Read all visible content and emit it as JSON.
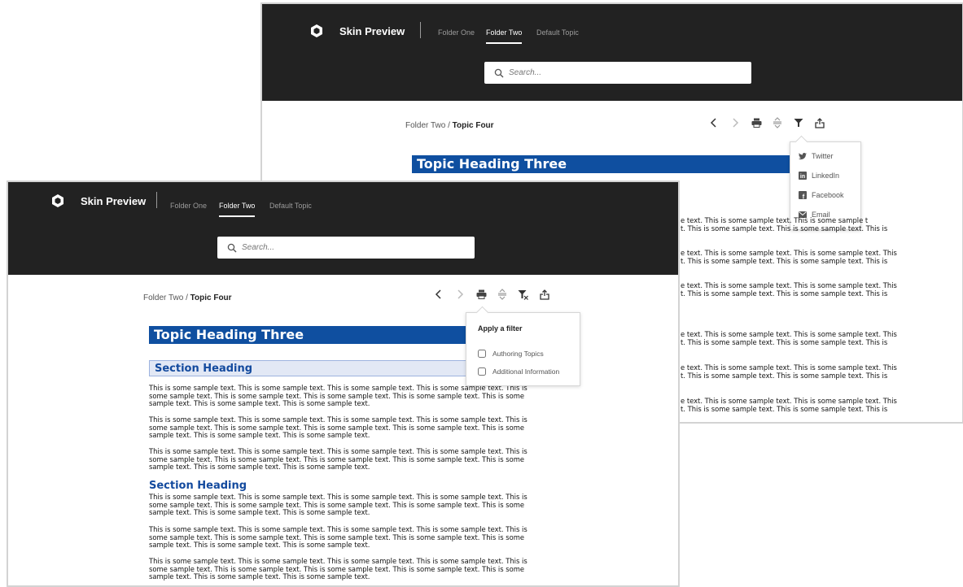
{
  "app": {
    "brand": "Skin Preview",
    "nav": [
      "Folder One",
      "Folder Two",
      "Default Topic"
    ],
    "active_nav": "Folder Two",
    "search_placeholder": "Search..."
  },
  "breadcrumb": {
    "parent": "Folder Two",
    "separator": "/",
    "current": "Topic Four"
  },
  "toolbar_icons": [
    "chevron-left-icon",
    "chevron-right-icon",
    "print-icon",
    "expand-collapse-icon",
    "filter-icon",
    "share-icon"
  ],
  "content": {
    "topic_heading": "Topic Heading Three",
    "section_heading": "Section Heading",
    "paragraph": "This is some sample text. This is some sample text. This is some sample text. This is some sample text. This is some sample text. This is some sample text. This is some sample text. This is some sample text. This is some sample text. This is some sample text. This is some sample text.",
    "fragments": {
      "a1": "e text. This is some sample text. This is some sample t",
      "a2": "t. This is some sample text. This is some sample text. This is",
      "b1": "e text. This is some sample text. This is some sample text. This",
      "b2": "t. This is some sample text. This is some sample text. This is"
    }
  },
  "share_menu": {
    "items": [
      "Twitter",
      "LinkedIn",
      "Facebook",
      "Email"
    ]
  },
  "filter_menu": {
    "title": "Apply a filter",
    "options": [
      "Authoring Topics",
      "Additional Information"
    ]
  },
  "colors": {
    "topbar": "#222222",
    "heading_blue": "#0f4fa0",
    "section_bg": "#e2e8f5",
    "section_text": "#134a9e"
  }
}
